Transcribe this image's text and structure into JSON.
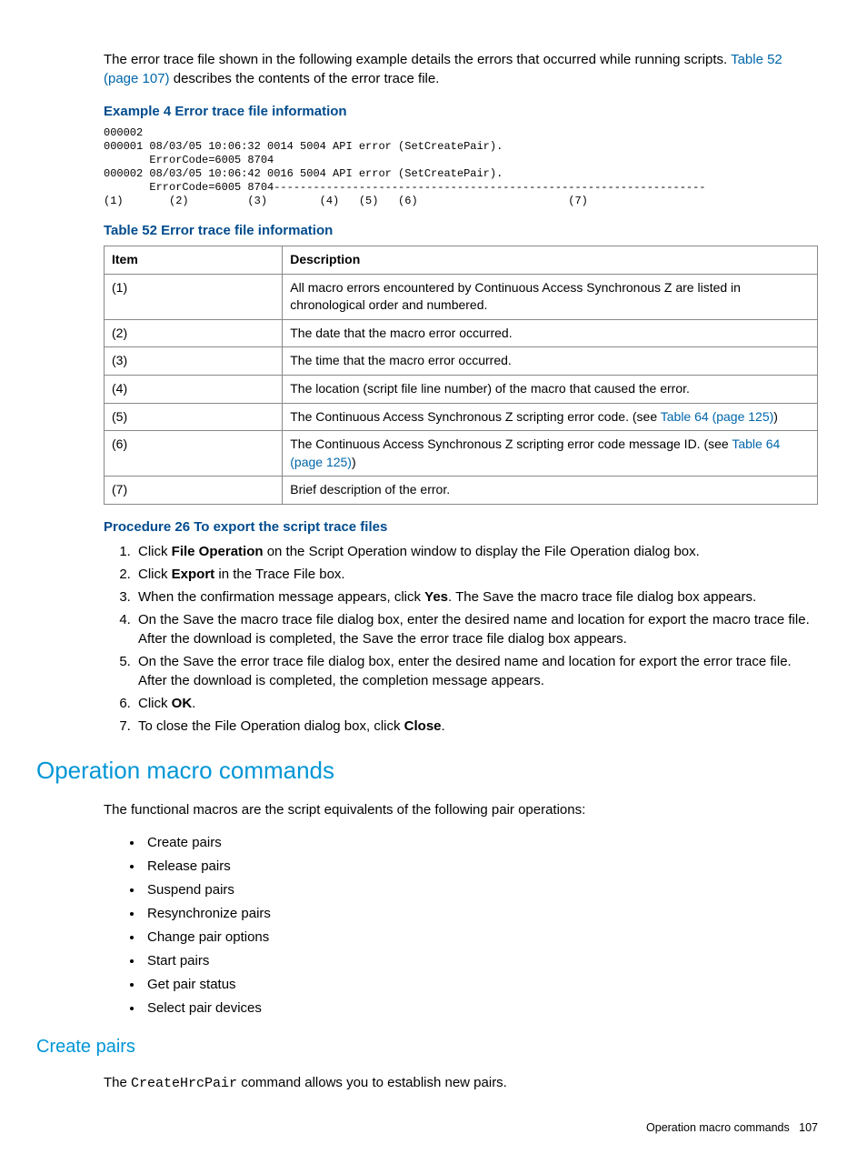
{
  "intro": {
    "pre": "The error trace file shown in the following example details the errors that occurred while running scripts. ",
    "link": "Table 52 (page 107)",
    "post": " describes the contents of the error trace file."
  },
  "example": {
    "title": "Example 4 Error trace file information",
    "code": "000002\n000001 08/03/05 10:06:32 0014 5004 API error (SetCreatePair).\n       ErrorCode=6005 8704\n000002 08/03/05 10:06:42 0016 5004 API error (SetCreatePair).\n       ErrorCode=6005 8704------------------------------------------------------------------\n(1)       (2)         (3)        (4)   (5)   (6)                       (7)"
  },
  "table": {
    "title": "Table 52 Error trace file information",
    "headers": {
      "item": "Item",
      "desc": "Description"
    },
    "rows": [
      {
        "item": "(1)",
        "desc": "All macro errors encountered by Continuous Access Synchronous Z are listed in chronological order and numbered."
      },
      {
        "item": "(2)",
        "desc": "The date that the macro error occurred."
      },
      {
        "item": "(3)",
        "desc": "The time that the macro error occurred."
      },
      {
        "item": "(4)",
        "desc": "The location (script file line number) of the macro that caused the error."
      },
      {
        "item": "(5)",
        "desc_pre": "The Continuous Access Synchronous Z scripting error code. (see ",
        "link": "Table 64 (page 125)",
        "desc_post": ")"
      },
      {
        "item": "(6)",
        "desc_pre": "The Continuous Access Synchronous Z scripting error code message ID. (see ",
        "link": "Table 64 (page 125)",
        "desc_post": ")"
      },
      {
        "item": "(7)",
        "desc": "Brief description of the error."
      }
    ]
  },
  "procedure": {
    "title": "Procedure 26 To export the script trace files",
    "steps": {
      "s1a": "Click ",
      "s1b": "File Operation",
      "s1c": " on the Script Operation window to display the File Operation dialog box.",
      "s2a": "Click ",
      "s2b": "Export",
      "s2c": " in the Trace File box.",
      "s3a": "When the confirmation message appears, click ",
      "s3b": "Yes",
      "s3c": ". The Save the macro trace file dialog box appears.",
      "s4": "On the Save the macro trace file dialog box, enter the desired name and location for export the macro trace file. After the download is completed, the Save the error trace file dialog box appears.",
      "s5": "On the Save the error trace file dialog box, enter the desired name and location for export the error trace file. After the download is completed, the completion message appears.",
      "s6a": "Click ",
      "s6b": "OK",
      "s6c": ".",
      "s7a": "To close the File Operation dialog box, click ",
      "s7b": "Close",
      "s7c": "."
    }
  },
  "section": {
    "title": "Operation macro commands",
    "intro": "The functional macros are the script equivalents of the following pair operations:",
    "bullets": [
      "Create pairs",
      "Release pairs",
      "Suspend pairs",
      "Resynchronize pairs",
      "Change pair options",
      "Start pairs",
      "Get pair status",
      "Select pair devices"
    ]
  },
  "subsection": {
    "title": "Create pairs",
    "text_pre": "The ",
    "code": "CreateHrcPair",
    "text_post": " command allows you to establish new pairs."
  },
  "footer": {
    "label": "Operation macro commands",
    "page": "107"
  }
}
